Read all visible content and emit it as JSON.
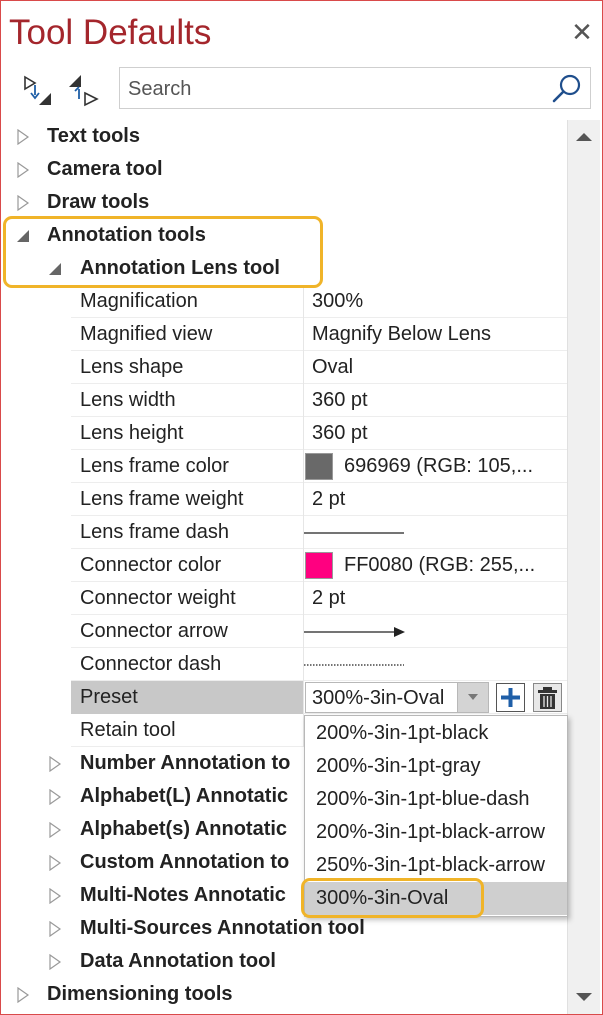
{
  "panel": {
    "title": "Tool Defaults",
    "close_icon": "close-icon",
    "search_placeholder": "Search"
  },
  "tree": {
    "text_tools": "Text tools",
    "camera_tool": "Camera tool",
    "draw_tools": "Draw tools",
    "annotation_tools": "Annotation tools",
    "annotation_lens_tool": "Annotation Lens tool",
    "number_annotation": "Number Annotation to",
    "alphabet_l": "Alphabet(L) Annotatic",
    "alphabet_s": "Alphabet(s) Annotatic",
    "custom_annotation": "Custom Annotation to",
    "multi_notes": "Multi-Notes Annotatic",
    "multi_sources": "Multi-Sources Annotation tool",
    "data_annotation": "Data Annotation tool",
    "dimensioning_tools": "Dimensioning tools"
  },
  "props": {
    "magnification": {
      "name": "Magnification",
      "value": "300%"
    },
    "magnified_view": {
      "name": "Magnified view",
      "value": "Magnify Below Lens"
    },
    "lens_shape": {
      "name": "Lens shape",
      "value": "Oval"
    },
    "lens_width": {
      "name": "Lens width",
      "value": "360 pt"
    },
    "lens_height": {
      "name": "Lens height",
      "value": "360 pt"
    },
    "lens_frame_color": {
      "name": "Lens frame color",
      "value": "696969 (RGB: 105,...",
      "color": "#696969"
    },
    "lens_frame_weight": {
      "name": "Lens frame weight",
      "value": "2 pt"
    },
    "lens_frame_dash": {
      "name": "Lens frame dash"
    },
    "connector_color": {
      "name": "Connector color",
      "value": "FF0080 (RGB: 255,...",
      "color": "#FF0080"
    },
    "connector_weight": {
      "name": "Connector weight",
      "value": "2 pt"
    },
    "connector_arrow": {
      "name": "Connector arrow"
    },
    "connector_dash": {
      "name": "Connector dash"
    },
    "preset": {
      "name": "Preset",
      "value": "300%-3in-Oval"
    },
    "retain_tool": {
      "name": "Retain tool"
    }
  },
  "dropdown": {
    "options": [
      "200%-3in-1pt-black",
      "200%-3in-1pt-gray",
      "200%-3in-1pt-blue-dash",
      "200%-3in-1pt-black-arrow",
      "250%-3in-1pt-black-arrow",
      "300%-3in-Oval"
    ],
    "selected": "300%-3in-Oval"
  },
  "colors": {
    "title": "#a4262c",
    "highlight": "#f0b429",
    "preset_row": "#c8c8c8",
    "add_button": "#1f5fa8"
  }
}
